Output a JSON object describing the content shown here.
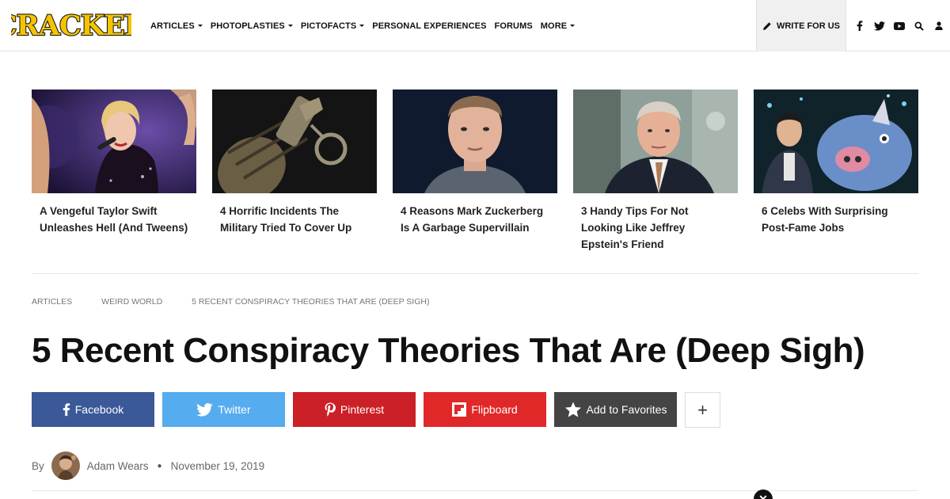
{
  "header": {
    "logo_text": "CRACKED",
    "nav": [
      {
        "label": "ARTICLES",
        "dropdown": true
      },
      {
        "label": "PHOTOPLASTIES",
        "dropdown": true
      },
      {
        "label": "PICTOFACTS",
        "dropdown": true
      },
      {
        "label": "PERSONAL EXPERIENCES",
        "dropdown": false
      },
      {
        "label": "FORUMS",
        "dropdown": false
      },
      {
        "label": "MORE",
        "dropdown": true
      }
    ],
    "write_for_us": "WRITE FOR US",
    "icons": [
      "facebook-icon",
      "twitter-icon",
      "youtube-icon",
      "search-icon",
      "user-icon"
    ]
  },
  "featured": [
    {
      "title": "A Vengeful Taylor Swift Unleashes Hell (And Tweens)"
    },
    {
      "title": "4 Horrific Incidents The Military Tried To Cover Up"
    },
    {
      "title": "4 Reasons Mark Zuckerberg Is A Garbage Supervillain"
    },
    {
      "title": "3 Handy Tips For Not Looking Like Jeffrey Epstein's Friend"
    },
    {
      "title": "6 Celebs With Surprising Post-Fame Jobs"
    }
  ],
  "breadcrumb": [
    "ARTICLES",
    "WEIRD WORLD",
    "5 RECENT CONSPIRACY THEORIES THAT ARE (DEEP SIGH)"
  ],
  "article": {
    "title": "5 Recent Conspiracy Theories That Are (Deep Sigh)",
    "by_label": "By",
    "author": "Adam Wears",
    "date": "November 19, 2019"
  },
  "share": [
    {
      "label": "Facebook",
      "color": "#3b5998",
      "icon": "facebook-icon"
    },
    {
      "label": "Twitter",
      "color": "#55acee",
      "icon": "twitter-icon"
    },
    {
      "label": "Pinterest",
      "color": "#cb2027",
      "icon": "pinterest-icon"
    },
    {
      "label": "Flipboard",
      "color": "#e12828",
      "icon": "flipboard-icon"
    },
    {
      "label": "Add to Favorites",
      "color": "#444444",
      "icon": "star-icon"
    }
  ],
  "more_share_symbol": "+",
  "close_symbol": "✕"
}
